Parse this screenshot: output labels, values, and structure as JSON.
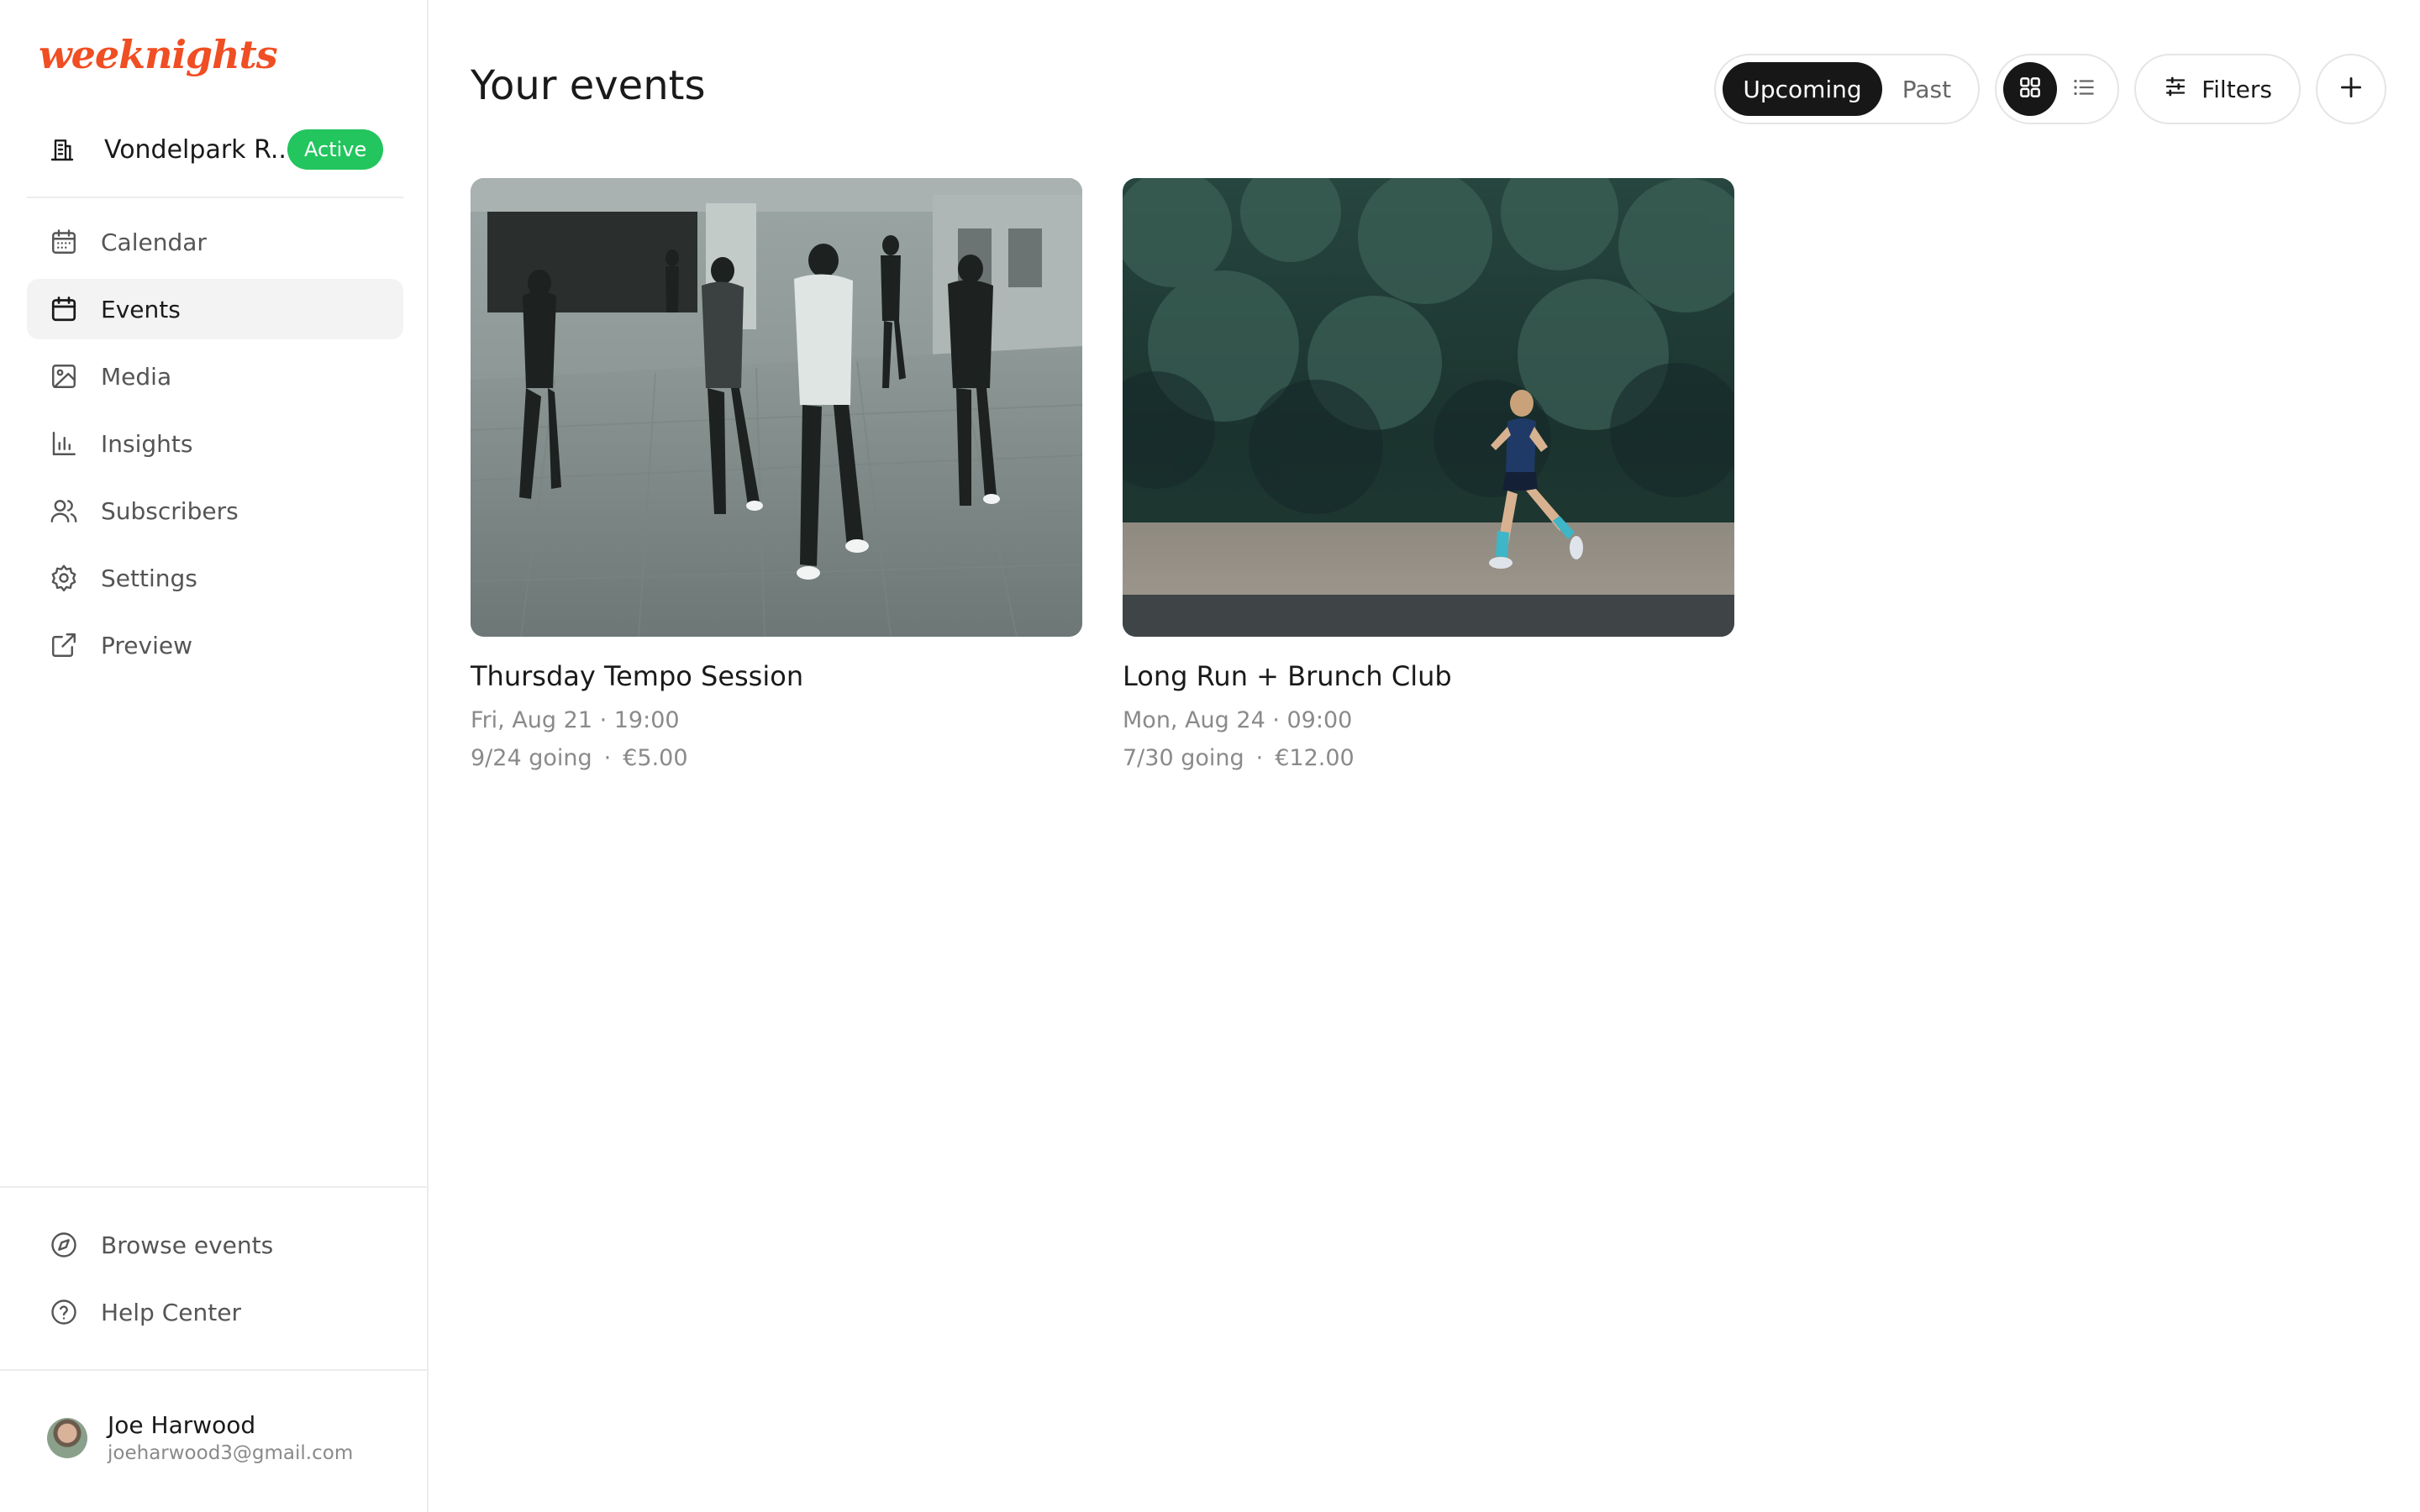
{
  "brand": {
    "logo_text": "weeknights",
    "accent": "#f04e23"
  },
  "workspace": {
    "name": "Vondelpark R...",
    "status": "Active",
    "status_color": "#22c55e",
    "icon": "building-icon"
  },
  "nav": {
    "items": [
      {
        "label": "Calendar",
        "icon": "calendar-grid-icon",
        "active": false
      },
      {
        "label": "Events",
        "icon": "calendar-icon",
        "active": true
      },
      {
        "label": "Media",
        "icon": "image-icon",
        "active": false
      },
      {
        "label": "Insights",
        "icon": "bar-chart-icon",
        "active": false
      },
      {
        "label": "Subscribers",
        "icon": "users-icon",
        "active": false
      },
      {
        "label": "Settings",
        "icon": "gear-icon",
        "active": false
      },
      {
        "label": "Preview",
        "icon": "external-link-icon",
        "active": false
      }
    ],
    "bottom_items": [
      {
        "label": "Browse events",
        "icon": "compass-icon"
      },
      {
        "label": "Help Center",
        "icon": "help-circle-icon"
      }
    ]
  },
  "user": {
    "name": "Joe Harwood",
    "email": "joeharwood3@gmail.com"
  },
  "main": {
    "title": "Your events",
    "tabs": [
      {
        "label": "Upcoming",
        "selected": true
      },
      {
        "label": "Past",
        "selected": false
      }
    ],
    "view_modes": [
      {
        "icon": "grid-view-icon",
        "selected": true
      },
      {
        "icon": "list-view-icon",
        "selected": false
      }
    ],
    "filters_label": "Filters",
    "add_icon": "plus-icon"
  },
  "events": [
    {
      "title": "Thursday Tempo Session",
      "date": "Fri, Aug 21 · 19:00",
      "going": "9/24 going",
      "separator": "·",
      "price": "€5.00"
    },
    {
      "title": "Long Run + Brunch Club",
      "date": "Mon, Aug 24 · 09:00",
      "going": "7/30 going",
      "separator": "·",
      "price": "€12.00"
    }
  ]
}
